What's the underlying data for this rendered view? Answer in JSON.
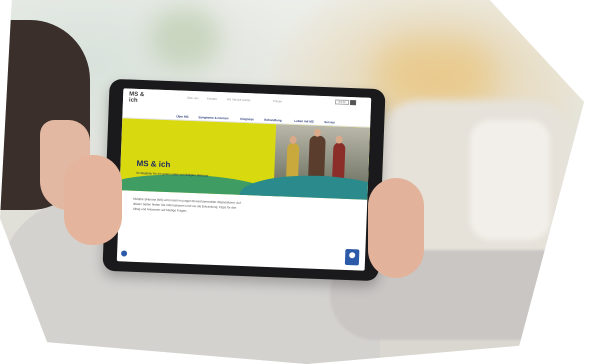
{
  "site": {
    "logo": "MS & ich",
    "utility_links": [
      "Über uns",
      "Kontakt",
      "MS Service Center",
      "Presse"
    ],
    "search_label": "Suche",
    "nav": [
      "Über MS",
      "Symptome & Formen",
      "Diagnose",
      "Behandlung",
      "Leben mit MS",
      "Service"
    ],
    "hero_title": "MS & ich",
    "hero_subtitle": "Ihr Begleiter für ein gutes Leben mit Multipler Sklerose",
    "intro_text": "Multiple Sklerose (MS) wird meist im jungen Erwachsenenalter diagnostiziert. Auf diesen Seiten finden Sie Informationen rund um die Erkrankung, Tipps für den Alltag und Antworten auf häufige Fragen."
  },
  "colors": {
    "hero_yellow": "#d8d90e",
    "brand_blue": "#1d2a63",
    "wave_green": "#3f9c63",
    "wave_teal": "#2a8a8c"
  }
}
